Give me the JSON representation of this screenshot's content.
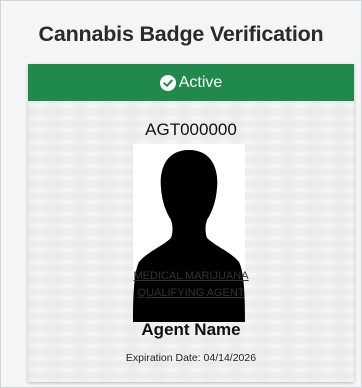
{
  "page": {
    "title": "Cannabis Badge Verification"
  },
  "badge": {
    "status_label": "Active",
    "status_icon": "check-circle-icon",
    "agent_id": "AGT000000",
    "card_title_line1": "MEDICAL MARIJUANA",
    "card_title_line2": "QUALIFYING AGENT",
    "agent_name": "Agent Name",
    "expiration": "Expiration Date: 04/14/2026"
  },
  "colors": {
    "status_green": "#1f8a4c",
    "card_background": "#eeeeee",
    "title_text": "#2a2a2a"
  }
}
